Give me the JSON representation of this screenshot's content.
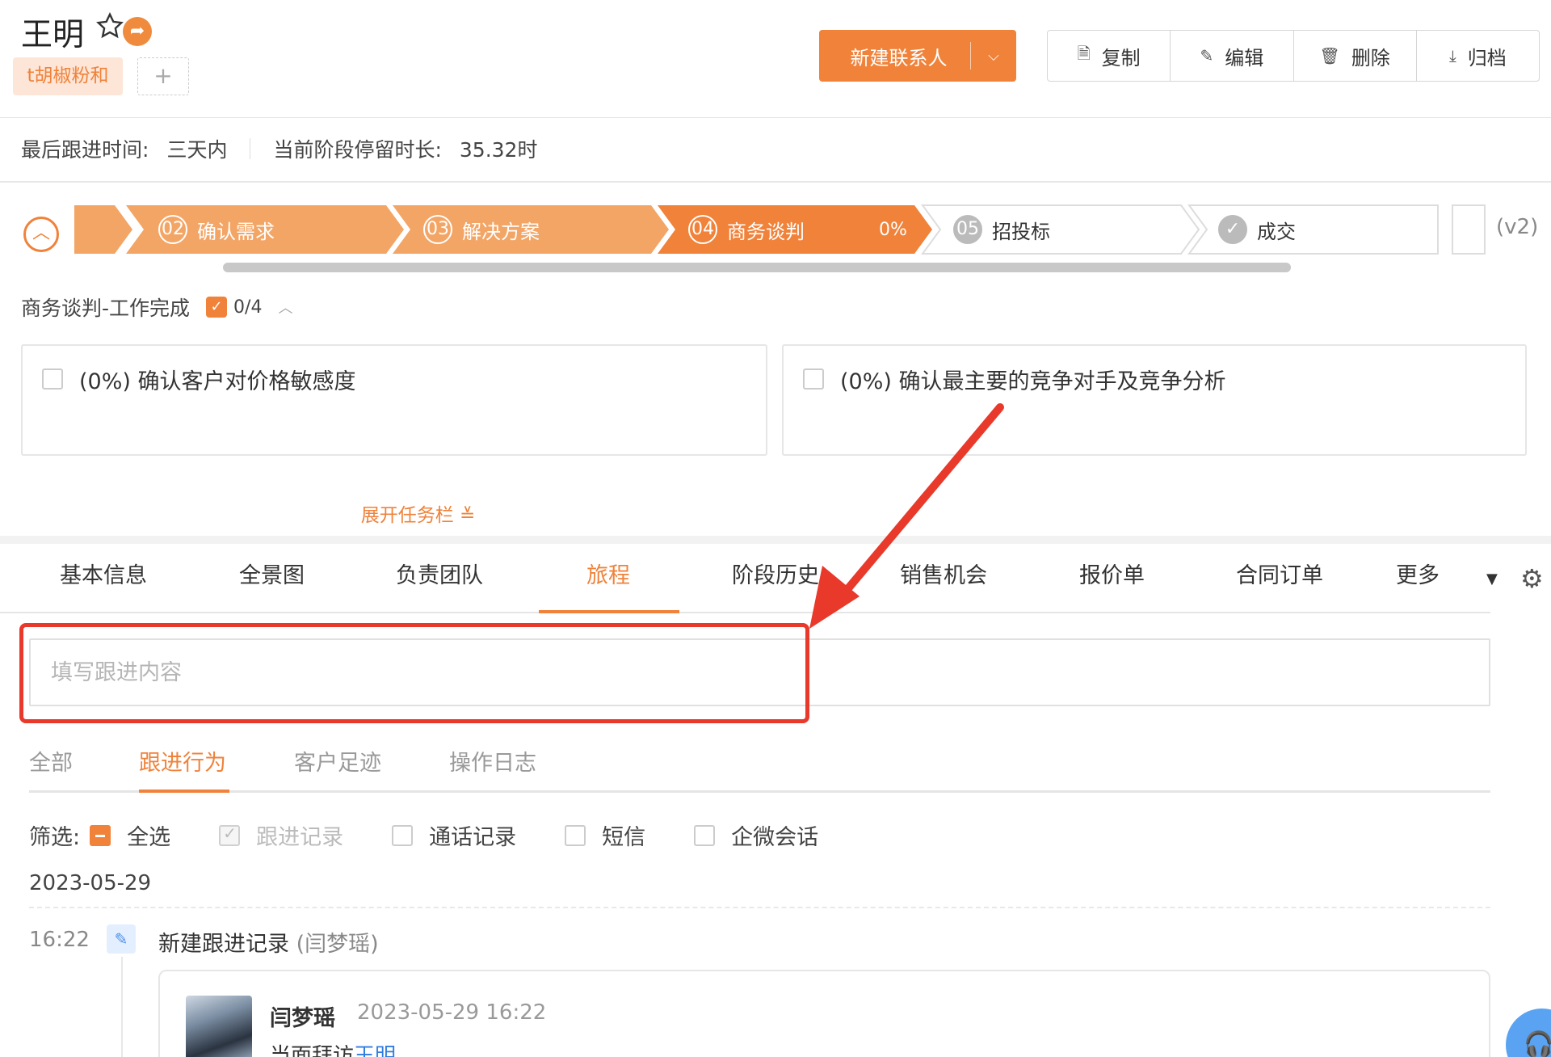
{
  "header": {
    "title": "王明",
    "tag": "t胡椒粉和",
    "add_tag": "+",
    "new_button": "新建联系人",
    "actions": [
      {
        "label": "复制",
        "icon": "copy-icon",
        "glyph": "🗎"
      },
      {
        "label": "编辑",
        "icon": "edit-icon",
        "glyph": "✎"
      },
      {
        "label": "删除",
        "icon": "trash-icon",
        "glyph": "🗑"
      },
      {
        "label": "归档",
        "icon": "archive-download-icon",
        "glyph": "⤓"
      }
    ]
  },
  "meta": {
    "last_followup_label": "最后跟进时间:",
    "last_followup_value": "三天内",
    "stay_label": "当前阶段停留时长:",
    "stay_value": "35.32时"
  },
  "stages": {
    "items": [
      {
        "num": "02",
        "label": "确认需求",
        "state": "done"
      },
      {
        "num": "03",
        "label": "解决方案",
        "state": "done"
      },
      {
        "num": "04",
        "label": "商务谈判",
        "state": "current"
      },
      {
        "num": "05",
        "label": "招投标",
        "state": "todo"
      },
      {
        "num": "",
        "label": "成交",
        "state": "todo"
      }
    ],
    "current_percent": "0%",
    "version": "(v2)"
  },
  "tasks": {
    "title": "商务谈判-工作完成",
    "count": "0/4",
    "items": [
      {
        "label": "(0%)  确认客户对价格敏感度"
      },
      {
        "label": "(0%)  确认最主要的竞争对手及竞争分析"
      }
    ],
    "expand_label": "展开任务栏"
  },
  "tabs": [
    "基本信息",
    "全景图",
    "负责团队",
    "旅程",
    "阶段历史",
    "销售机会",
    "报价单",
    "合同订单",
    "更多"
  ],
  "active_tab": "旅程",
  "followup_input": {
    "placeholder": "填写跟进内容",
    "value": ""
  },
  "subtabs": [
    "全部",
    "跟进行为",
    "客户足迹",
    "操作日志"
  ],
  "active_subtab": "跟进行为",
  "filter": {
    "label": "筛选:",
    "options": [
      {
        "label": "全选",
        "state": "indeterminate"
      },
      {
        "label": "跟进记录",
        "state": "checked-disabled"
      },
      {
        "label": "通话记录",
        "state": "unchecked"
      },
      {
        "label": "短信",
        "state": "unchecked"
      },
      {
        "label": "企微会话",
        "state": "unchecked"
      }
    ]
  },
  "timeline": {
    "date": "2023-05-29",
    "entry": {
      "time": "16:22",
      "title": "新建跟进记录",
      "by": "(闫梦瑶)",
      "author": "闫梦瑶",
      "datetime": "2023-05-29 16:22",
      "desc_prefix": "当面拜访",
      "desc_link": "王明"
    }
  },
  "colors": {
    "accent": "#f0823a",
    "annotation": "#e8392a",
    "link": "#2f7de1"
  }
}
